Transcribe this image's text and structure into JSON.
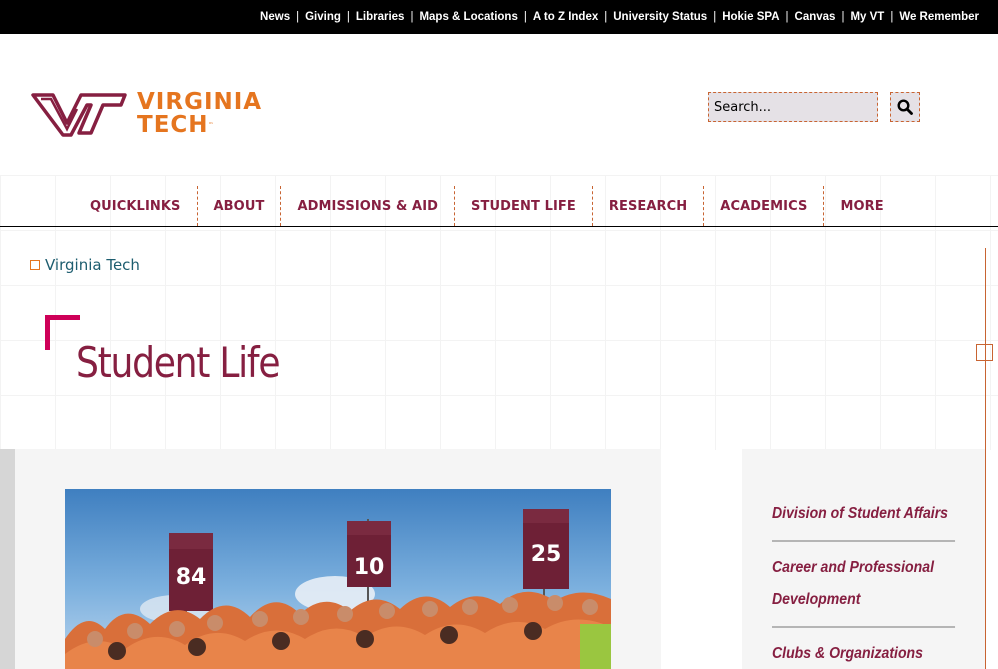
{
  "utility_nav": {
    "items": [
      "News",
      "Giving",
      "Libraries",
      "Maps & Locations",
      "A to Z Index",
      "University Status",
      "Hokie SPA",
      "Canvas",
      "My VT",
      "We Remember"
    ]
  },
  "logo": {
    "line1": "VIRGINIA",
    "line2": "TECH",
    "tm": "™"
  },
  "search": {
    "placeholder": "Search..."
  },
  "main_nav": {
    "items": [
      "QUICKLINKS",
      "ABOUT",
      "ADMISSIONS & AID",
      "STUDENT LIFE",
      "RESEARCH",
      "ACADEMICS",
      "MORE"
    ]
  },
  "breadcrumb": {
    "label": "Virginia Tech"
  },
  "page": {
    "title": "Student Life"
  },
  "photo": {
    "signs": [
      "84",
      "10",
      "25"
    ]
  },
  "sidebar": {
    "links": [
      {
        "lines": [
          "Division of Student Affairs"
        ]
      },
      {
        "lines": [
          "Career and Professional",
          "Development"
        ]
      },
      {
        "lines": [
          "Clubs & Organizations"
        ]
      }
    ]
  },
  "colors": {
    "maroon": "#861f41",
    "orange": "#e5751f",
    "accent_pink": "#ce0058",
    "teal_link": "#1d5d6f",
    "utility_bg": "#000000"
  },
  "icons": {
    "search": "magnifier-icon",
    "breadcrumb": "square-outline-icon"
  }
}
